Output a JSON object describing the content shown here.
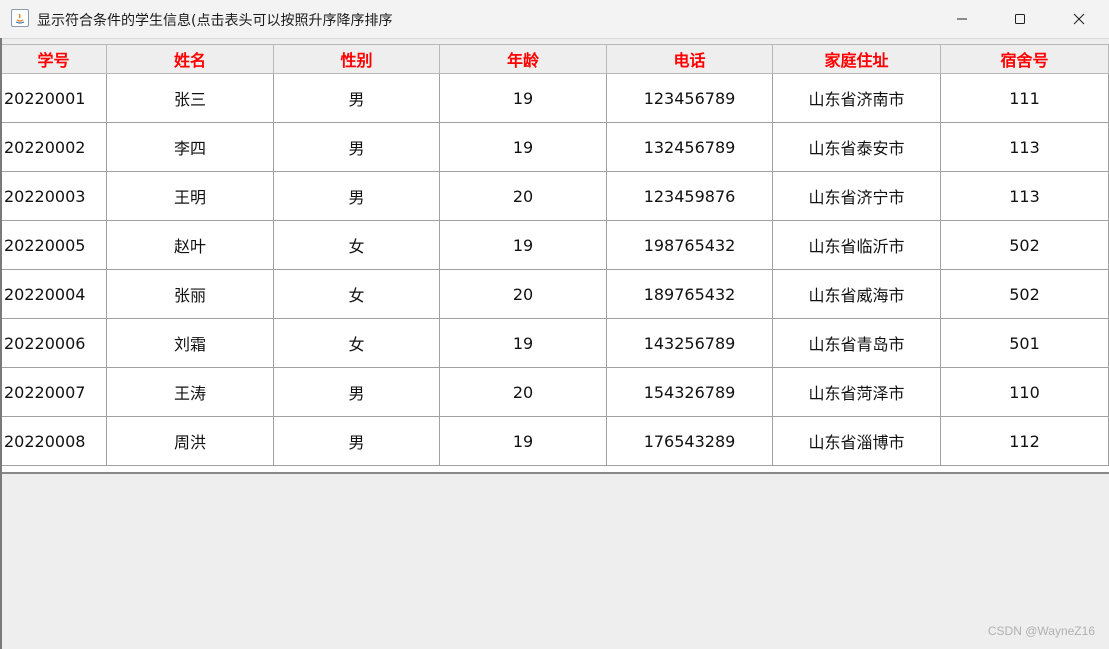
{
  "window": {
    "title": "显示符合条件的学生信息(点击表头可以按照升序降序排序",
    "icon": "java-icon"
  },
  "table": {
    "columns": [
      "学号",
      "姓名",
      "性别",
      "年龄",
      "电话",
      "家庭住址",
      "宿舍号"
    ],
    "header_color": "#ff0000",
    "rows": [
      [
        "20220001",
        "张三",
        "男",
        "19",
        "123456789",
        "山东省济南市",
        "111"
      ],
      [
        "20220002",
        "李四",
        "男",
        "19",
        "132456789",
        "山东省泰安市",
        "113"
      ],
      [
        "20220003",
        "王明",
        "男",
        "20",
        "123459876",
        "山东省济宁市",
        "113"
      ],
      [
        "20220005",
        "赵叶",
        "女",
        "19",
        "198765432",
        "山东省临沂市",
        "502"
      ],
      [
        "20220004",
        "张丽",
        "女",
        "20",
        "189765432",
        "山东省威海市",
        "502"
      ],
      [
        "20220006",
        "刘霜",
        "女",
        "19",
        "143256789",
        "山东省青岛市",
        "501"
      ],
      [
        "20220007",
        "王涛",
        "男",
        "20",
        "154326789",
        "山东省菏泽市",
        "110"
      ],
      [
        "20220008",
        "周洪",
        "男",
        "19",
        "176543289",
        "山东省淄博市",
        "112"
      ]
    ]
  },
  "watermark": "CSDN @WayneZ16"
}
